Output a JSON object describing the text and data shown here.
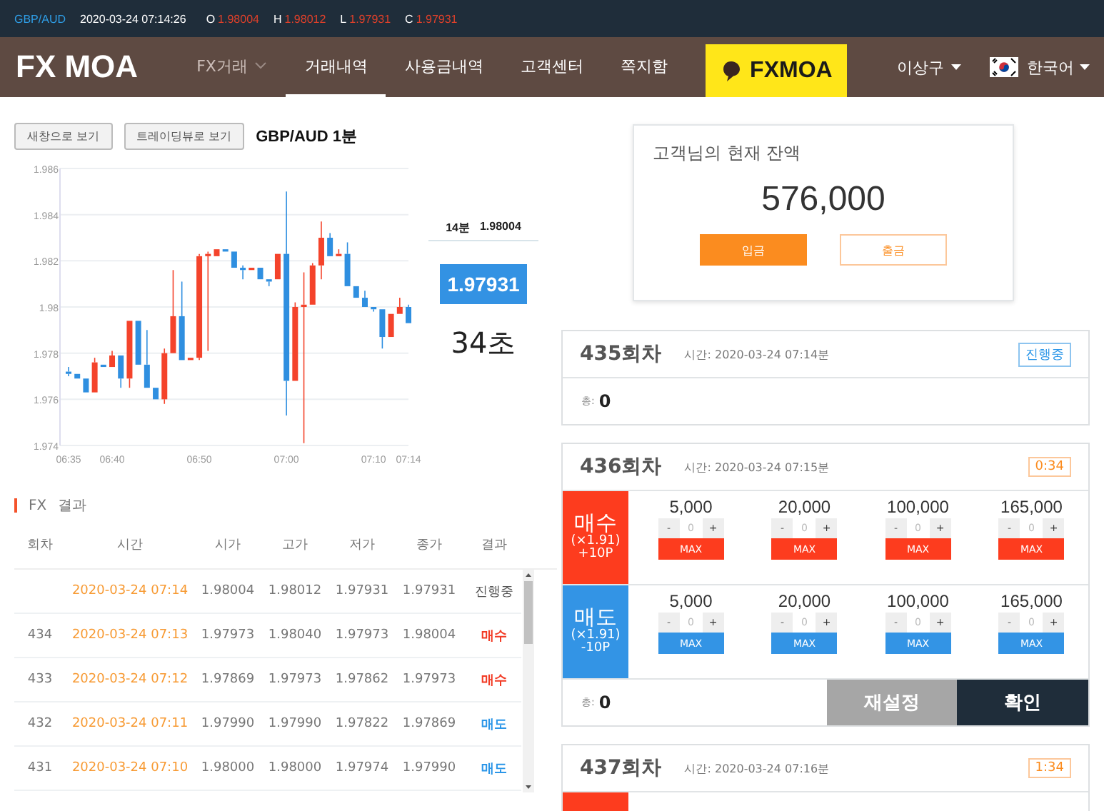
{
  "ticker": {
    "symbol": "GBP/AUD",
    "datetime": "2020-03-24 07:14:26",
    "quotes": [
      {
        "label": "O",
        "value": "1.98004"
      },
      {
        "label": "H",
        "value": "1.98012"
      },
      {
        "label": "L",
        "value": "1.97931"
      },
      {
        "label": "C",
        "value": "1.97931"
      }
    ]
  },
  "nav": {
    "logo": "FX MOA",
    "items": [
      {
        "label": "FX거래",
        "dropdown": true,
        "selected": false
      },
      {
        "label": "거래내역",
        "dropdown": false,
        "selected": true
      },
      {
        "label": "사용금내역",
        "dropdown": false,
        "selected": false
      },
      {
        "label": "고객센터",
        "dropdown": false,
        "selected": false
      },
      {
        "label": "쪽지함",
        "dropdown": false,
        "selected": false
      }
    ],
    "banner": "FXMOA",
    "user": "이상구",
    "language": "한국어"
  },
  "chart_buttons": [
    "새창으로 보기",
    "트레이딩뷰로 보기"
  ],
  "chart_data": {
    "type": "candlestick",
    "title": "GBP/AUD 1분",
    "grid": true,
    "ylim": [
      1.974,
      1.986
    ],
    "yticks": [
      1.974,
      1.976,
      1.978,
      1.98,
      1.982,
      1.984,
      1.986
    ],
    "categories": [
      "06:35",
      null,
      null,
      null,
      null,
      "06:40",
      null,
      null,
      null,
      null,
      null,
      null,
      null,
      null,
      null,
      "06:50",
      null,
      null,
      null,
      null,
      null,
      null,
      null,
      null,
      null,
      "07:00",
      null,
      null,
      null,
      null,
      null,
      null,
      null,
      null,
      null,
      "07:10",
      null,
      null,
      null,
      "07:14"
    ],
    "ohlc": [
      [
        1.9772,
        1.9774,
        1.977,
        1.9771
      ],
      [
        1.9771,
        1.9771,
        1.9769,
        1.9769
      ],
      [
        1.9769,
        1.9769,
        1.9763,
        1.9763
      ],
      [
        1.9763,
        1.9778,
        1.9763,
        1.9776
      ],
      [
        1.9775,
        1.9775,
        1.9774,
        1.9774
      ],
      [
        1.9774,
        1.9781,
        1.9774,
        1.9779
      ],
      [
        1.9779,
        1.9779,
        1.9765,
        1.9769
      ],
      [
        1.9769,
        1.9794,
        1.9765,
        1.9794
      ],
      [
        1.9794,
        1.9794,
        1.9775,
        1.9775
      ],
      [
        1.9775,
        1.979,
        1.9765,
        1.9765
      ],
      [
        1.9765,
        1.9765,
        1.976,
        1.976
      ],
      [
        1.976,
        1.9782,
        1.9758,
        1.978
      ],
      [
        1.978,
        1.9816,
        1.978,
        1.9796
      ],
      [
        1.9796,
        1.9811,
        1.9777,
        1.9777
      ],
      [
        1.9777,
        1.9778,
        1.9777,
        1.9778
      ],
      [
        1.9778,
        1.9823,
        1.9777,
        1.9822
      ],
      [
        1.9822,
        1.9824,
        1.9781,
        1.9823
      ],
      [
        1.9822,
        1.9825,
        1.9822,
        1.9825
      ],
      [
        1.9825,
        1.9825,
        1.9824,
        1.9824
      ],
      [
        1.9824,
        1.9824,
        1.9817,
        1.9817
      ],
      [
        1.9817,
        1.9818,
        1.9812,
        1.9816
      ],
      [
        1.9816,
        1.9817,
        1.9816,
        1.9817
      ],
      [
        1.9817,
        1.9817,
        1.9812,
        1.9812
      ],
      [
        1.9812,
        1.9812,
        1.9809,
        1.9811
      ],
      [
        1.9812,
        1.9823,
        1.9812,
        1.9823
      ],
      [
        1.9823,
        1.985,
        1.9753,
        1.9768
      ],
      [
        1.9768,
        1.9802,
        1.9768,
        1.98
      ],
      [
        1.98,
        1.9815,
        1.9741,
        1.9801
      ],
      [
        1.9801,
        1.9819,
        1.9801,
        1.9818
      ],
      [
        1.9818,
        1.9837,
        1.9812,
        1.983
      ],
      [
        1.983,
        1.9832,
        1.9822,
        1.9822
      ],
      [
        1.9822,
        1.9825,
        1.9822,
        1.9823
      ],
      [
        1.9823,
        1.9828,
        1.9809,
        1.9809
      ],
      [
        1.9809,
        1.9809,
        1.9804,
        1.9804
      ],
      [
        1.9804,
        1.9807,
        1.98,
        1.98
      ],
      [
        1.98,
        1.98,
        1.9798,
        1.9799
      ],
      [
        1.9799,
        1.9799,
        1.9782,
        1.9787
      ],
      [
        1.9787,
        1.9797,
        1.9787,
        1.9797
      ],
      [
        1.9797,
        1.9804,
        1.9797,
        1.98
      ],
      [
        1.98,
        1.9801,
        1.9793,
        1.9793
      ]
    ]
  },
  "chart_side": {
    "minute": "14분",
    "open": "1.98004",
    "price": "1.97931",
    "countdown": "34초"
  },
  "results": {
    "title_prefix": "FX",
    "title": "결과",
    "columns": [
      "회차",
      "시간",
      "시가",
      "고가",
      "저가",
      "종가",
      "결과"
    ],
    "rows": [
      {
        "time": "2020-03-24 07:14",
        "open": "1.98004",
        "high": "1.98012",
        "low": "1.97931",
        "close": "1.97931",
        "result": "진행중",
        "kind": "pending"
      },
      {
        "round": "434",
        "time": "2020-03-24 07:13",
        "open": "1.97973",
        "high": "1.98040",
        "low": "1.97973",
        "close": "1.98004",
        "result": "매수",
        "kind": "buy"
      },
      {
        "round": "433",
        "time": "2020-03-24 07:12",
        "open": "1.97869",
        "high": "1.97973",
        "low": "1.97862",
        "close": "1.97973",
        "result": "매수",
        "kind": "buy"
      },
      {
        "round": "432",
        "time": "2020-03-24 07:11",
        "open": "1.97990",
        "high": "1.97990",
        "low": "1.97822",
        "close": "1.97869",
        "result": "매도",
        "kind": "sell"
      },
      {
        "round": "431",
        "time": "2020-03-24 07:10",
        "open": "1.98000",
        "high": "1.98000",
        "low": "1.97974",
        "close": "1.97990",
        "result": "매도",
        "kind": "sell"
      }
    ]
  },
  "balance": {
    "title": "고객님의 현재 잔액",
    "amount": "576,000",
    "deposit": "입금",
    "withdraw": "출금"
  },
  "rounds": [
    {
      "kind": "summary",
      "title": "435회차",
      "time": "시간: 2020-03-24 07:14분",
      "badge": "진행중",
      "total_label": "총:",
      "total": "0"
    },
    {
      "kind": "bet",
      "title": "436회차",
      "time": "시간: 2020-03-24 07:15분",
      "badge": "0:34",
      "total_label": "총:",
      "total": "0",
      "reset": "재설정",
      "confirm": "확인",
      "sides": [
        {
          "kind": "buy",
          "label": "매수",
          "odds": "(×1.91)",
          "points": "+10P",
          "options": [
            {
              "amount": "5,000",
              "minus": "-",
              "value": "0",
              "plus": "+",
              "max": "MAX"
            },
            {
              "amount": "20,000",
              "minus": "-",
              "value": "0",
              "plus": "+",
              "max": "MAX"
            },
            {
              "amount": "100,000",
              "minus": "-",
              "value": "0",
              "plus": "+",
              "max": "MAX"
            },
            {
              "amount": "165,000",
              "minus": "-",
              "value": "0",
              "plus": "+",
              "max": "MAX"
            }
          ]
        },
        {
          "kind": "sell",
          "label": "매도",
          "odds": "(×1.91)",
          "points": "-10P",
          "options": [
            {
              "amount": "5,000",
              "minus": "-",
              "value": "0",
              "plus": "+",
              "max": "MAX"
            },
            {
              "amount": "20,000",
              "minus": "-",
              "value": "0",
              "plus": "+",
              "max": "MAX"
            },
            {
              "amount": "100,000",
              "minus": "-",
              "value": "0",
              "plus": "+",
              "max": "MAX"
            },
            {
              "amount": "165,000",
              "minus": "-",
              "value": "0",
              "plus": "+",
              "max": "MAX"
            }
          ]
        }
      ]
    },
    {
      "kind": "preview",
      "title": "437회차",
      "time": "시간: 2020-03-24 07:16분",
      "badge": "1:34"
    }
  ]
}
